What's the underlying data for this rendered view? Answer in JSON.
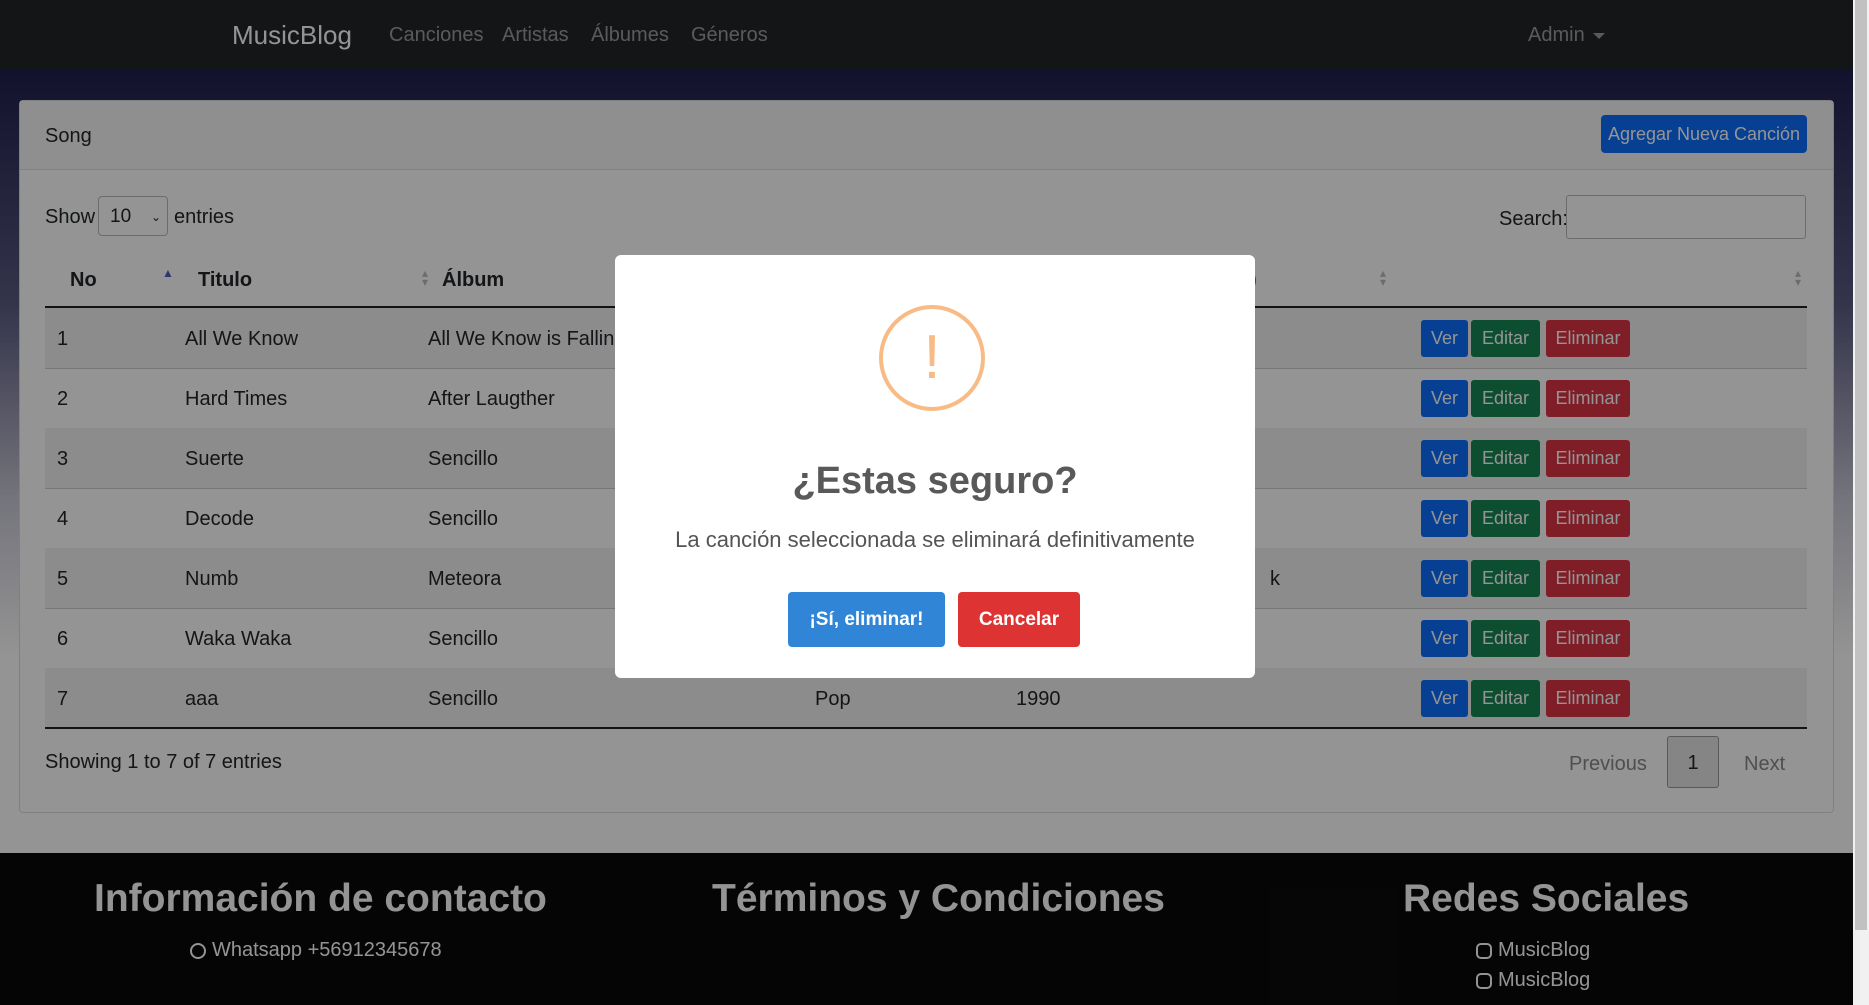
{
  "navbar": {
    "brand": "MusicBlog",
    "links": [
      "Canciones",
      "Artistas",
      "Álbumes",
      "Géneros"
    ],
    "admin_label": "Admin"
  },
  "card": {
    "title": "Song",
    "add_button": "Agregar Nueva Canción"
  },
  "controls": {
    "show_label": "Show",
    "page_size": "10",
    "entries_label": "entries",
    "search_label": "Search:",
    "search_value": ""
  },
  "table": {
    "headers": [
      "No",
      "Titulo",
      "Álbum",
      ")"
    ],
    "rows": [
      {
        "no": "1",
        "title": "All We Know",
        "album": "All We Know is Falling",
        "genre": "",
        "year": "",
        "extra": ""
      },
      {
        "no": "2",
        "title": "Hard Times",
        "album": "After Laugther",
        "genre": "",
        "year": "",
        "extra": ""
      },
      {
        "no": "3",
        "title": "Suerte",
        "album": "Sencillo",
        "genre": "",
        "year": "",
        "extra": ""
      },
      {
        "no": "4",
        "title": "Decode",
        "album": "Sencillo",
        "genre": "",
        "year": "",
        "extra": ""
      },
      {
        "no": "5",
        "title": "Numb",
        "album": "Meteora",
        "genre": "",
        "year": "",
        "extra": "k"
      },
      {
        "no": "6",
        "title": "Waka Waka",
        "album": "Sencillo",
        "genre": "",
        "year": "",
        "extra": ""
      },
      {
        "no": "7",
        "title": "aaa",
        "album": "Sencillo",
        "genre": "Pop",
        "year": "1990",
        "extra": ""
      }
    ],
    "actions": {
      "view": "Ver",
      "edit": "Editar",
      "delete": "Eliminar"
    }
  },
  "footer_info": {
    "showing": "Showing 1 to 7 of 7 entries",
    "previous": "Previous",
    "page": "1",
    "next": "Next"
  },
  "site_footer": {
    "contact_title": "Información de contacto",
    "whatsapp": "Whatsapp +56912345678",
    "terms_title": "Términos y Condiciones",
    "social_title": "Redes Sociales",
    "instagram": "MusicBlog",
    "facebook": "MusicBlog"
  },
  "modal": {
    "icon": "!",
    "title": "¿Estas seguro?",
    "text": "La canción seleccionada se eliminará definitivamente",
    "confirm": "¡Sí, eliminar!",
    "cancel": "Cancelar"
  },
  "colors": {
    "primary": "#0d6efd",
    "success": "#198754",
    "danger": "#dc3545",
    "swal_confirm": "#3085d6",
    "swal_cancel": "#dd3333",
    "warning_icon": "#f8bb86"
  }
}
